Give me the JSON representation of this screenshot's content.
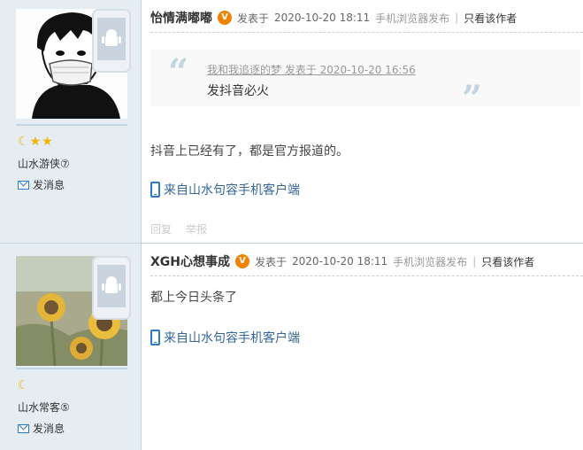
{
  "posts": [
    {
      "author": "怡情满嘟嘟",
      "verified_badge": "V",
      "posted_label": "发表于",
      "posted_time": "2020-10-20 18:11",
      "via": "手机浏览器发布",
      "separator": "|",
      "only_author": "只看该作者",
      "avatar_icon": "cartoon-person-with-mask",
      "rank_icons": [
        "moon",
        "star",
        "star"
      ],
      "group_title": "山水游侠⑦",
      "send_message": "发消息",
      "quote": {
        "meta": "我和我追逐的梦 发表于 2020-10-20 16:56",
        "text": "发抖音必火"
      },
      "content": "抖音上已经有了，都是官方报道的。",
      "client_link": "来自山水句容手机客户端",
      "reply": "回复",
      "report": "举报"
    },
    {
      "author": "XGH心想事成",
      "verified_badge": "V",
      "posted_label": "发表于",
      "posted_time": "2020-10-20 18:11",
      "via": "手机浏览器发布",
      "separator": "|",
      "only_author": "只看该作者",
      "avatar_icon": "sunflower-photo",
      "rank_icons": [
        "moon"
      ],
      "group_title": "山水常客⑤",
      "send_message": "发消息",
      "content": "都上今日头条了",
      "client_link": "来自山水句容手机客户端"
    }
  ],
  "colors": {
    "link": "#336699",
    "badge": "#f08200",
    "sidebar_bg": "#e5edf2",
    "star": "#f0b400"
  }
}
